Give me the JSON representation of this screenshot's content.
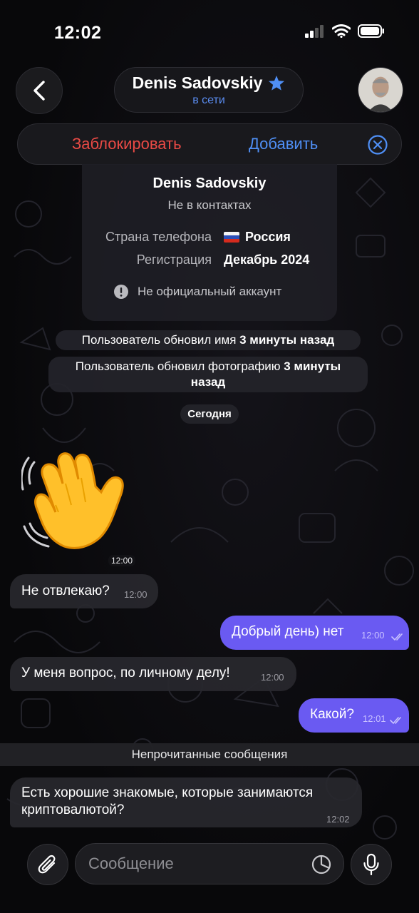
{
  "status_bar": {
    "time": "12:02"
  },
  "header": {
    "name": "Denis Sadovskiy",
    "status": "в сети"
  },
  "action_bar": {
    "block_label": "Заблокировать",
    "add_label": "Добавить"
  },
  "info_card": {
    "name": "Denis Sadovskiy",
    "subtitle": "Не в контактах",
    "rows": [
      {
        "label": "Страна телефона",
        "value": "Россия"
      },
      {
        "label": "Регистрация",
        "value": "Декабрь 2024"
      }
    ],
    "note": "Не официальный аккаунт"
  },
  "service_messages": [
    {
      "text": "Пользователь обновил имя ",
      "bold": "3 минуты назад"
    },
    {
      "text": "Пользователь обновил фотографию ",
      "bold": "3 минуты назад"
    }
  ],
  "date_chip": "Сегодня",
  "messages": [
    {
      "type": "sticker",
      "time": "12:00"
    },
    {
      "direction": "in",
      "text": "Не отвлекаю?",
      "time": "12:00"
    },
    {
      "direction": "out",
      "text": "Добрый день) нет",
      "time": "12:00"
    },
    {
      "direction": "in",
      "text": "У меня вопрос, по личному делу!",
      "time": "12:00"
    },
    {
      "direction": "out",
      "text": "Какой?",
      "time": "12:01"
    },
    {
      "direction": "in",
      "text": "Есть хорошие знакомые, которые занимаются криптовалютой?",
      "time": "12:02"
    }
  ],
  "unread_label": "Непрочитанные сообщения",
  "composer": {
    "placeholder": "Сообщение"
  },
  "colors": {
    "accent": "#4f8ff5",
    "danger": "#ea4a45",
    "outgoing_bubble": "#6a5af2",
    "online": "#5a8cf0"
  }
}
